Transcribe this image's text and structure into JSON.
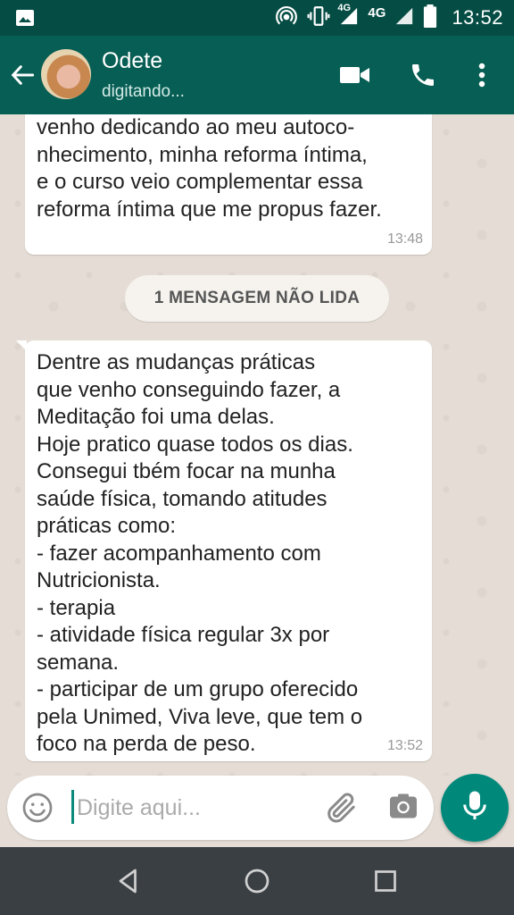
{
  "status_bar": {
    "time": "13:52",
    "network_label": "4G",
    "network_label_small": "4G",
    "icons": [
      "image-icon",
      "hotspot-icon",
      "vibrate-icon",
      "signal-icon",
      "battery-icon"
    ]
  },
  "header": {
    "contact_name": "Odete",
    "contact_status": "digitando...",
    "icons": [
      "back-arrow-icon",
      "video-call-icon",
      "phone-icon",
      "more-vert-icon"
    ]
  },
  "messages": [
    {
      "text": "venho dedicando ao meu autoco-\nnhecimento, minha reforma íntima,\ne o curso veio complementar essa\nreforma íntima que me propus fazer.",
      "time": "13:48"
    },
    {
      "text": "Dentre as mudanças práticas\nque venho conseguindo fazer, a\nMeditação foi uma delas.\nHoje pratico quase todos os dias.\nConsegui tbém focar na munha\nsaúde física, tomando atitudes\npráticas como:\n- fazer acompanhamento com\nNutricionista.\n- terapia\n- atividade física regular 3x por\nsemana.\n- participar de um grupo oferecido\npela Unimed, Viva leve, que tem o\nfoco na perda de peso.",
      "time": "13:52"
    }
  ],
  "unread_divider": "1 MENSAGEM NÃO LIDA",
  "composer": {
    "placeholder": "Digite aqui...",
    "value": "",
    "icons": [
      "emoji-icon",
      "attach-icon",
      "camera-icon",
      "mic-icon"
    ]
  },
  "colors": {
    "header": "#075e54",
    "status_bar": "#054d44",
    "chat_bg": "#e5ddd5",
    "bubble": "#ffffff",
    "accent": "#00897b"
  }
}
